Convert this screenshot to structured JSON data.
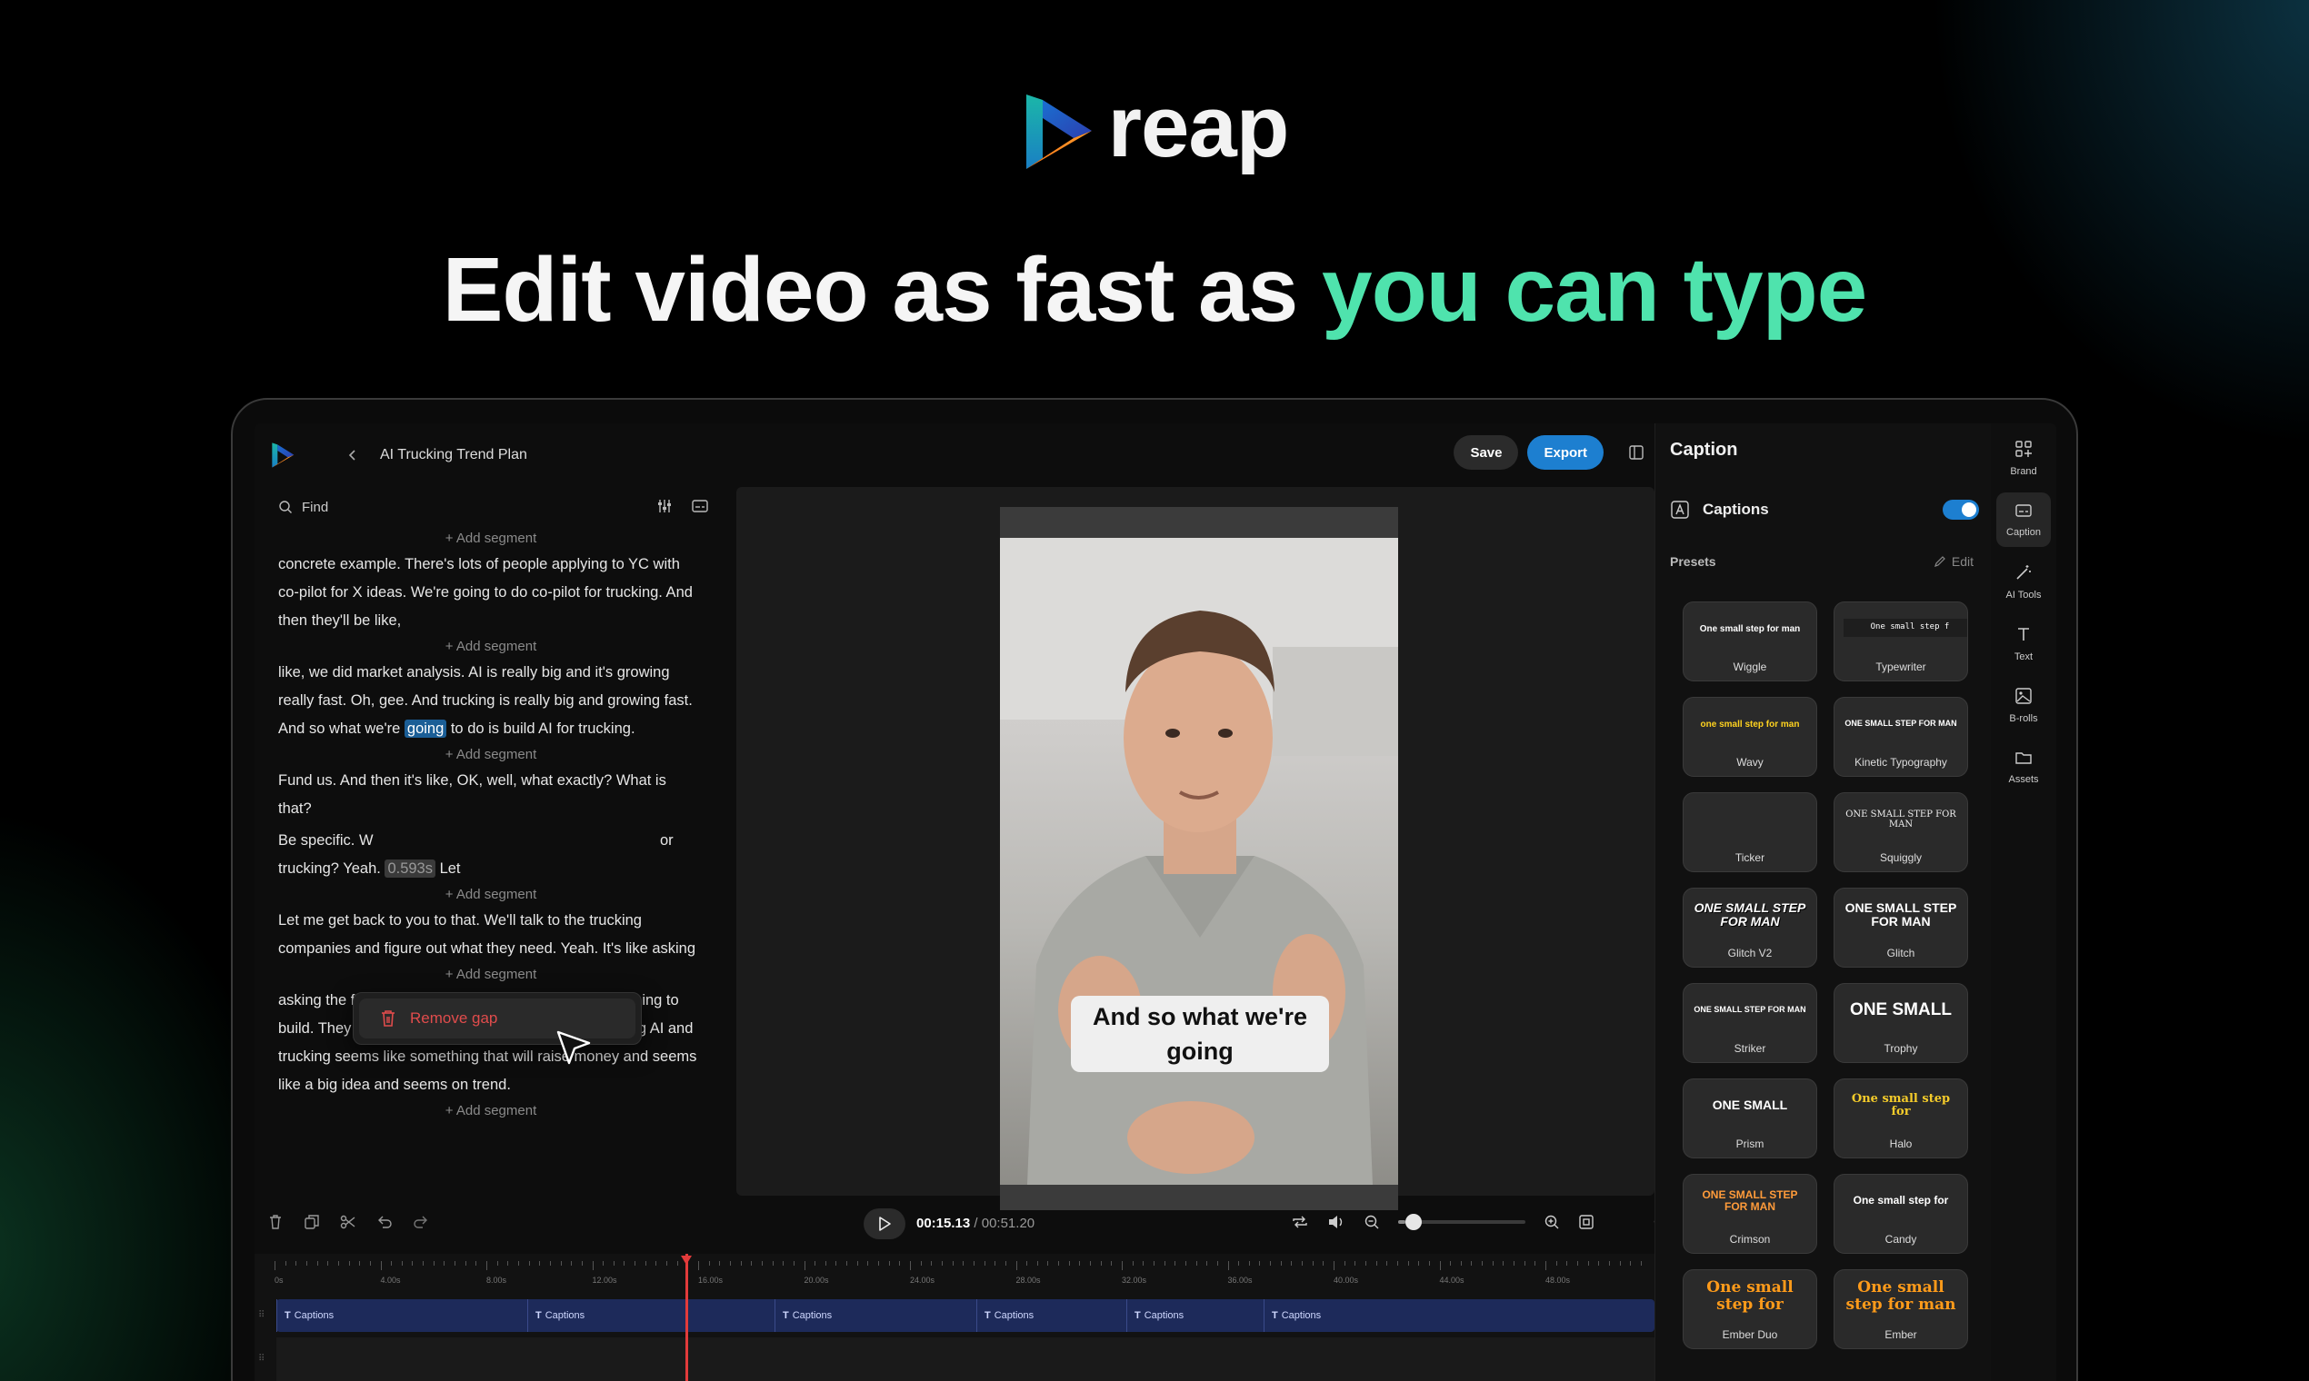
{
  "hero": {
    "brand_name": "reap",
    "headline_main": "Edit video as fast as ",
    "headline_accent": "you can type"
  },
  "colors": {
    "accent_green": "#4fe3ad",
    "primary_blue": "#1d7fd0",
    "danger_red": "#e04c4c",
    "playhead_red": "#e23b3b"
  },
  "editor": {
    "back_icon": "chevron-left-icon",
    "project_title": "AI Trucking Trend Plan",
    "save_label": "Save",
    "export_label": "Export"
  },
  "transcript": {
    "find_placeholder": "Find",
    "add_segment_label": "+ Add segment",
    "segments": [
      "concrete example. There's lots of people applying to YC with co-pilot for X ideas. We're going to do co-pilot for trucking. And then they'll be like,",
      {
        "before": "like, we did market analysis. AI is really big and it's growing really fast. Oh, gee. And trucking is really big and growing fast. And so what we're ",
        "highlight": "going",
        "after": " to do is build AI for trucking."
      },
      "Fund us. And then it's like, OK, well, what exactly? What is that?",
      {
        "line1_start": "Be specific. W",
        "line1_end": "or",
        "line2_start": "trucking? Yeah. ",
        "gap": "0.593s",
        "line2_end": " Let"
      },
      "Let me get back to you to that. We'll talk to the trucking companies and figure out what they need. Yeah. It's like asking",
      "asking the founder of the precise exact thing they're going to build. They hadn't thought that far ahead. It's combining AI and trucking seems like something that will raise money and seems like a big idea and seems on trend."
    ],
    "context_menu": {
      "remove_gap_label": "Remove gap",
      "icon": "trash-icon"
    }
  },
  "preview": {
    "caption_text": "And so what we're going"
  },
  "player": {
    "current_time": "00:15.13",
    "separator": " / ",
    "total_time": "00:51.20",
    "zoom_level": 0.06
  },
  "timeline": {
    "ticks": [
      "0s",
      "4.00s",
      "8.00s",
      "12.00s",
      "16.00s",
      "20.00s",
      "24.00s",
      "28.00s",
      "32.00s",
      "36.00s",
      "40.00s",
      "44.00s",
      "48.00s"
    ],
    "caption_clips": [
      "Captions",
      "Captions",
      "Captions",
      "Captions",
      "Captions",
      "Captions"
    ]
  },
  "caption_panel": {
    "title": "Caption",
    "captions_label": "Captions",
    "captions_enabled": true,
    "presets_label": "Presets",
    "edit_label": "Edit",
    "presets": [
      {
        "name": "Wiggle",
        "sample": "One small step for man"
      },
      {
        "name": "Typewriter",
        "sample": "One small step f"
      },
      {
        "name": "Wavy",
        "sample": "one small step for man"
      },
      {
        "name": "Kinetic Typography",
        "sample": "ONE SMALL STEP FOR MAN"
      },
      {
        "name": "Ticker",
        "sample": ""
      },
      {
        "name": "Squiggly",
        "sample": "ONE SMALL STEP FOR MAN"
      },
      {
        "name": "Glitch V2",
        "sample": "ONE SMALL STEP FOR MAN"
      },
      {
        "name": "Glitch",
        "sample": "ONE SMALL STEP FOR MAN"
      },
      {
        "name": "Striker",
        "sample": "ONE SMALL STEP FOR MAN"
      },
      {
        "name": "Trophy",
        "sample": "ONE SMALL"
      },
      {
        "name": "Prism",
        "sample": "ONE SMALL"
      },
      {
        "name": "Halo",
        "sample": "One small step for"
      },
      {
        "name": "Crimson",
        "sample": "ONE SMALL STEP FOR MAN"
      },
      {
        "name": "Candy",
        "sample": "One small step for"
      },
      {
        "name": "Ember Duo",
        "sample": "One small step for"
      },
      {
        "name": "Ember",
        "sample": "One small step for man"
      }
    ]
  },
  "rail": [
    {
      "label": "Brand",
      "icon": "brand-grid-icon"
    },
    {
      "label": "Caption",
      "icon": "caption-icon"
    },
    {
      "label": "AI Tools",
      "icon": "magic-wand-icon"
    },
    {
      "label": "Text",
      "icon": "text-icon"
    },
    {
      "label": "B-rolls",
      "icon": "image-icon"
    },
    {
      "label": "Assets",
      "icon": "folder-icon"
    }
  ]
}
